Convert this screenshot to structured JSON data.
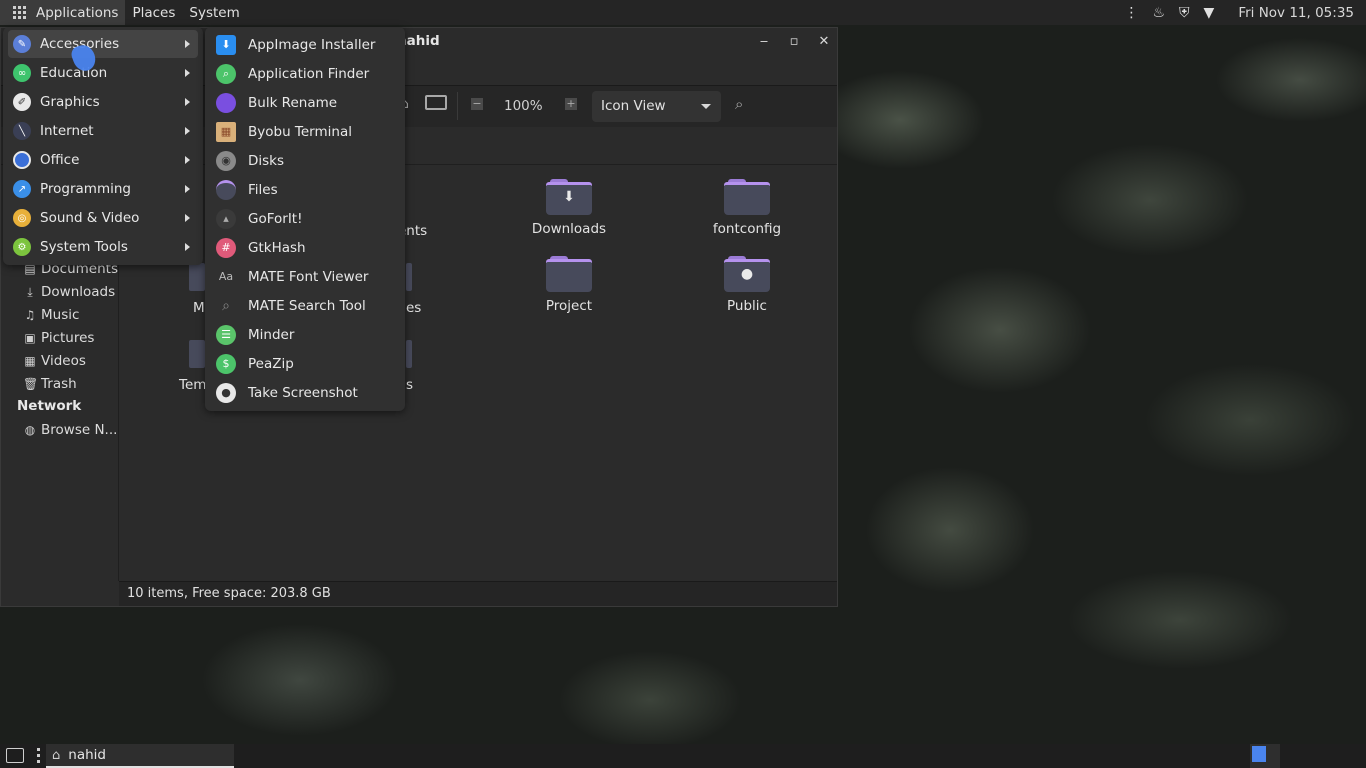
{
  "top_panel": {
    "menus": [
      "Applications",
      "Places",
      "System"
    ],
    "clock": "Fri Nov 11, 05:35",
    "tray_icons": [
      "handle-icon",
      "flame-icon",
      "security-shield-icon",
      "wifi-icon"
    ]
  },
  "file_manager": {
    "title": "nahid",
    "zoom": "100%",
    "view_mode": "Icon View",
    "status": "10 items, Free space: 203.8 GB",
    "sidebar": {
      "places": [
        {
          "label": "Documents",
          "icon": "document-icon"
        },
        {
          "label": "Downloads",
          "icon": "download-icon"
        },
        {
          "label": "Music",
          "icon": "music-icon"
        },
        {
          "label": "Pictures",
          "icon": "picture-icon"
        },
        {
          "label": "Videos",
          "icon": "video-icon"
        },
        {
          "label": "Trash",
          "icon": "trash-icon"
        }
      ],
      "network_heading": "Network",
      "network_items": [
        {
          "label": "Browse N...",
          "icon": "network-icon"
        }
      ]
    },
    "folders": [
      {
        "label": "Downloads",
        "emblem": "download"
      },
      {
        "label": "fontconfig",
        "emblem": ""
      },
      {
        "label": "Project",
        "emblem": ""
      },
      {
        "label": "Public",
        "emblem": "user"
      }
    ],
    "partial_labels": [
      "ents",
      "M",
      "es",
      "Tem",
      "s"
    ]
  },
  "apps_menu": {
    "categories": [
      {
        "label": "Accessories",
        "icon": "accessories-icon",
        "color": "#5b7fd8"
      },
      {
        "label": "Education",
        "icon": "education-icon",
        "color": "#3ec46d"
      },
      {
        "label": "Graphics",
        "icon": "graphics-icon",
        "color": "#e8e8e8"
      },
      {
        "label": "Internet",
        "icon": "internet-icon",
        "color": "#3a3f55"
      },
      {
        "label": "Office",
        "icon": "office-icon",
        "color": "#3a6fd8"
      },
      {
        "label": "Programming",
        "icon": "programming-icon",
        "color": "#3a8fe8"
      },
      {
        "label": "Sound & Video",
        "icon": "sound-video-icon",
        "color": "#e8b03a"
      },
      {
        "label": "System Tools",
        "icon": "system-tools-icon",
        "color": "#7cc43e"
      }
    ],
    "accessories": [
      {
        "label": "AppImage Installer",
        "icon": "appimage-icon",
        "color": "#2a8ef0"
      },
      {
        "label": "Application Finder",
        "icon": "app-finder-icon",
        "color": "#4cc46a"
      },
      {
        "label": "Bulk Rename",
        "icon": "bulk-rename-icon",
        "color": "#7a4fe0"
      },
      {
        "label": "Byobu Terminal",
        "icon": "byobu-icon",
        "color": "#d9b07a"
      },
      {
        "label": "Disks",
        "icon": "disks-icon",
        "color": "#8a8a8a"
      },
      {
        "label": "Files",
        "icon": "files-icon",
        "color": "#474a5b"
      },
      {
        "label": "GoForIt!",
        "icon": "goforit-icon",
        "color": "#3a3a3a"
      },
      {
        "label": "GtkHash",
        "icon": "gtkhash-icon",
        "color": "#e05a7a"
      },
      {
        "label": "MATE Font Viewer",
        "icon": "font-viewer-icon",
        "color": "#303030"
      },
      {
        "label": "MATE Search Tool",
        "icon": "search-tool-icon",
        "color": "#303030"
      },
      {
        "label": "Minder",
        "icon": "minder-icon",
        "color": "#5ac46a"
      },
      {
        "label": "PeaZip",
        "icon": "peazip-icon",
        "color": "#4cc46a"
      },
      {
        "label": "Take Screenshot",
        "icon": "screenshot-icon",
        "color": "#e8e8e8"
      }
    ]
  },
  "bottom_panel": {
    "task_label": "nahid"
  }
}
